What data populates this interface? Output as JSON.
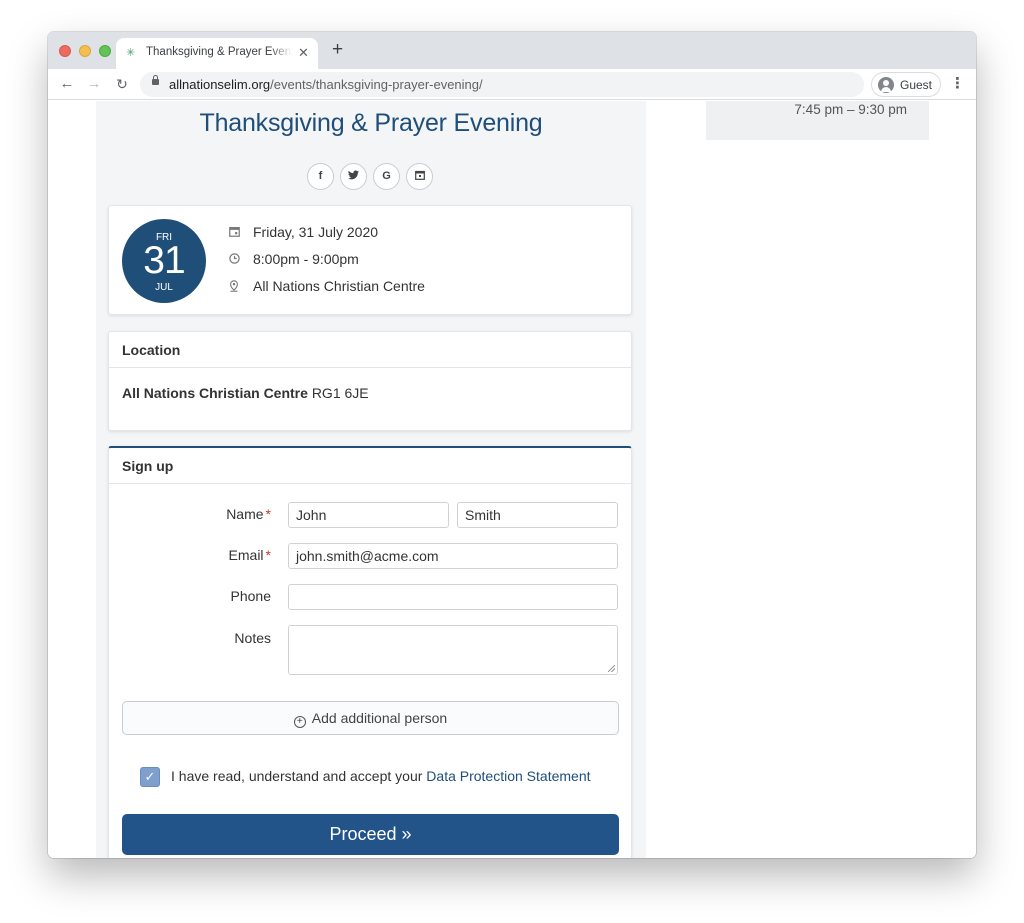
{
  "browser": {
    "tab_title": "Thanksgiving & Prayer Evening",
    "tab_close": "✕",
    "new_tab": "+",
    "url_domain": "allnationselim.org",
    "url_path": "/events/thanksgiving-prayer-evening/",
    "profile_label": "Guest",
    "icons": {
      "back": "back-arrow-icon",
      "forward": "forward-arrow-icon",
      "reload": "reload-icon",
      "lock": "lock-icon",
      "menu": "more-vert-icon"
    }
  },
  "sidebar": {
    "time_range": "7:45 pm – 9:30 pm"
  },
  "event": {
    "title": "Thanksgiving & Prayer Evening",
    "share_buttons": [
      {
        "label": "f",
        "icon": "facebook-icon"
      },
      {
        "label": "🐦",
        "icon": "twitter-icon"
      },
      {
        "label": "G",
        "icon": "google-icon"
      },
      {
        "label": "📅",
        "icon": "calendar-export-icon"
      }
    ],
    "date_badge": {
      "day_of_week": "FRI",
      "day": "31",
      "month": "JUL"
    },
    "date": "Friday, 31 July 2020",
    "time": "8:00pm - 9:00pm",
    "venue": "All Nations Christian Centre"
  },
  "location": {
    "heading": "Location",
    "venue_name": "All Nations Christian Centre",
    "postcode": "RG1 6JE"
  },
  "signup": {
    "heading": "Sign up",
    "name_label": "Name",
    "email_label": "Email",
    "phone_label": "Phone",
    "notes_label": "Notes",
    "required_marker": "*",
    "first_name_value": "John",
    "last_name_value": "Smith",
    "email_value": "john.smith@acme.com",
    "phone_value": "",
    "notes_value": "",
    "add_person_label": "Add additional person",
    "consent_checked": true,
    "consent_text": "I have read, understand and accept your",
    "consent_link": "Data Protection Statement",
    "proceed_label": "Proceed »"
  },
  "colors": {
    "brand": "#1f4e79",
    "button": "#22548a",
    "required": "#c0392b"
  }
}
